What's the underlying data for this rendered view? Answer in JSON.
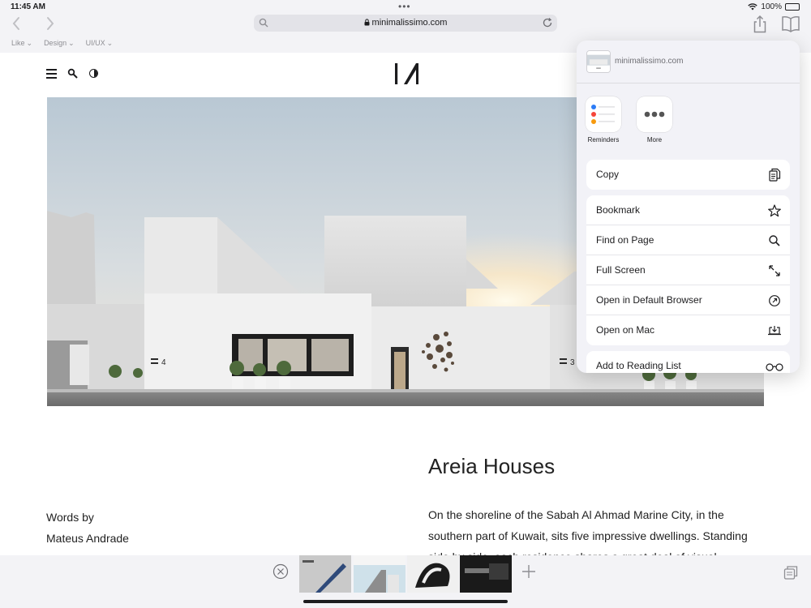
{
  "status": {
    "time": "11:45 AM",
    "battery": "100%"
  },
  "browser": {
    "url": "minimalissimo.com",
    "favorites": [
      "Like",
      "Design",
      "UI/UX"
    ]
  },
  "site": {
    "logo": "I/",
    "article_title": "Areia Houses",
    "words_by_label": "Words by",
    "author": "Mateus Andrade",
    "body": "On the shoreline of the Sabah Al Ahmad Marine City, in the southern part of Kuwait, sits five impressive dwellings. Standing side by side, each residence shares a great deal of visual elements",
    "house_numbers": [
      "4",
      "3"
    ]
  },
  "share_sheet": {
    "site": "minimalissimo.com",
    "apps": [
      {
        "label": "Reminders",
        "icon": "reminders-icon"
      },
      {
        "label": "More",
        "icon": "more-icon"
      }
    ],
    "copy": {
      "label": "Copy",
      "icon": "copy-icon"
    },
    "actions": [
      {
        "label": "Bookmark",
        "icon": "star-icon"
      },
      {
        "label": "Find on Page",
        "icon": "search-icon"
      },
      {
        "label": "Full Screen",
        "icon": "expand-icon"
      },
      {
        "label": "Open in Default Browser",
        "icon": "compass-icon"
      },
      {
        "label": "Open on Mac",
        "icon": "laptop-icon"
      }
    ],
    "reading_list": {
      "label": "Add to Reading List",
      "icon": "glasses-icon"
    }
  },
  "tabs": {
    "thumbnails": [
      "tab-pen",
      "tab-architecture",
      "tab-chair",
      "tab-dark-product"
    ]
  },
  "colors": {
    "chrome": "#f3f3f6",
    "sheet": "#f2f2f7",
    "accent": "#1c1c1e"
  }
}
